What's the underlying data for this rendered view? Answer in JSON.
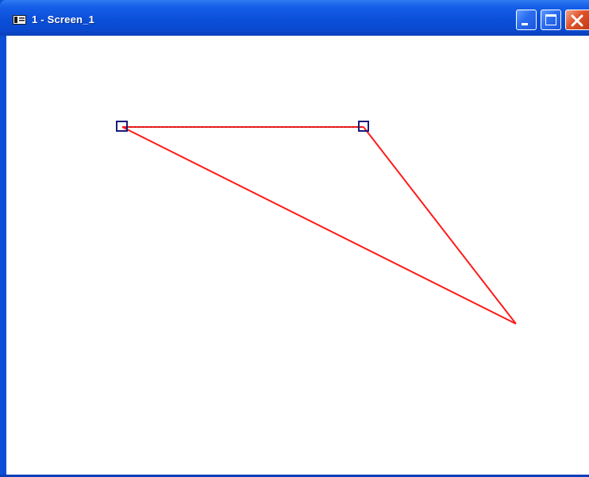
{
  "window": {
    "title": "1 - Screen_1",
    "app_icon": "window-icon",
    "buttons": {
      "minimize": "minimize-icon",
      "maximize": "maximize-icon",
      "close": "close-icon"
    }
  },
  "canvas": {
    "shape": "triangle",
    "line_color": "#ff1a1a",
    "handle_color": "#1a1a7a"
  }
}
